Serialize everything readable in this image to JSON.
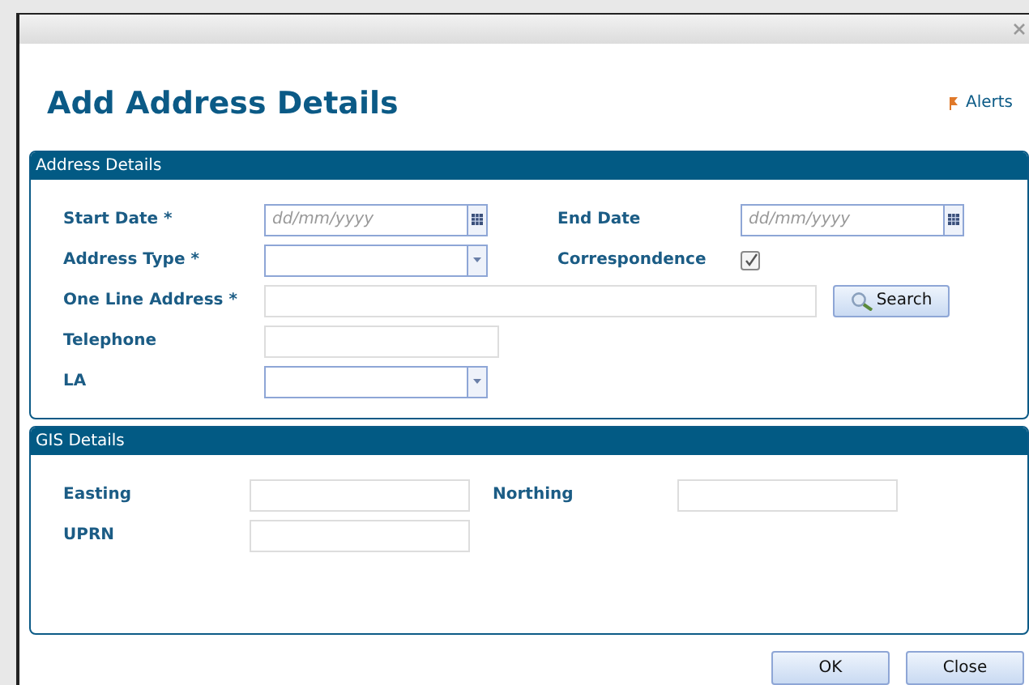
{
  "dialog": {
    "heading": "Add Address Details",
    "alerts_link": "Alerts"
  },
  "panels": [
    {
      "title": "Address Details",
      "rows": [
        [
          {
            "kind": "date",
            "label": "Start Date *",
            "placeholder": "dd/mm/yyyy"
          },
          {
            "kind": "date",
            "label": "End Date",
            "placeholder": "dd/mm/yyyy"
          }
        ],
        [
          {
            "kind": "select",
            "label": "Address Type *"
          },
          {
            "kind": "checkbox",
            "label": "Correspondence",
            "checked": true
          }
        ],
        [
          {
            "kind": "long_text",
            "label": "One Line Address *",
            "button": "Search"
          }
        ],
        [
          {
            "kind": "text",
            "label": "Telephone"
          }
        ],
        [
          {
            "kind": "select",
            "label": "LA"
          }
        ]
      ]
    },
    {
      "title": "GIS Details",
      "rows": [
        [
          {
            "kind": "short_text",
            "label": "Easting"
          },
          {
            "kind": "short_text",
            "label": "Northing"
          }
        ],
        [
          {
            "kind": "short_text",
            "label": "UPRN"
          }
        ]
      ]
    }
  ],
  "buttons": [
    "OK",
    "Close"
  ]
}
